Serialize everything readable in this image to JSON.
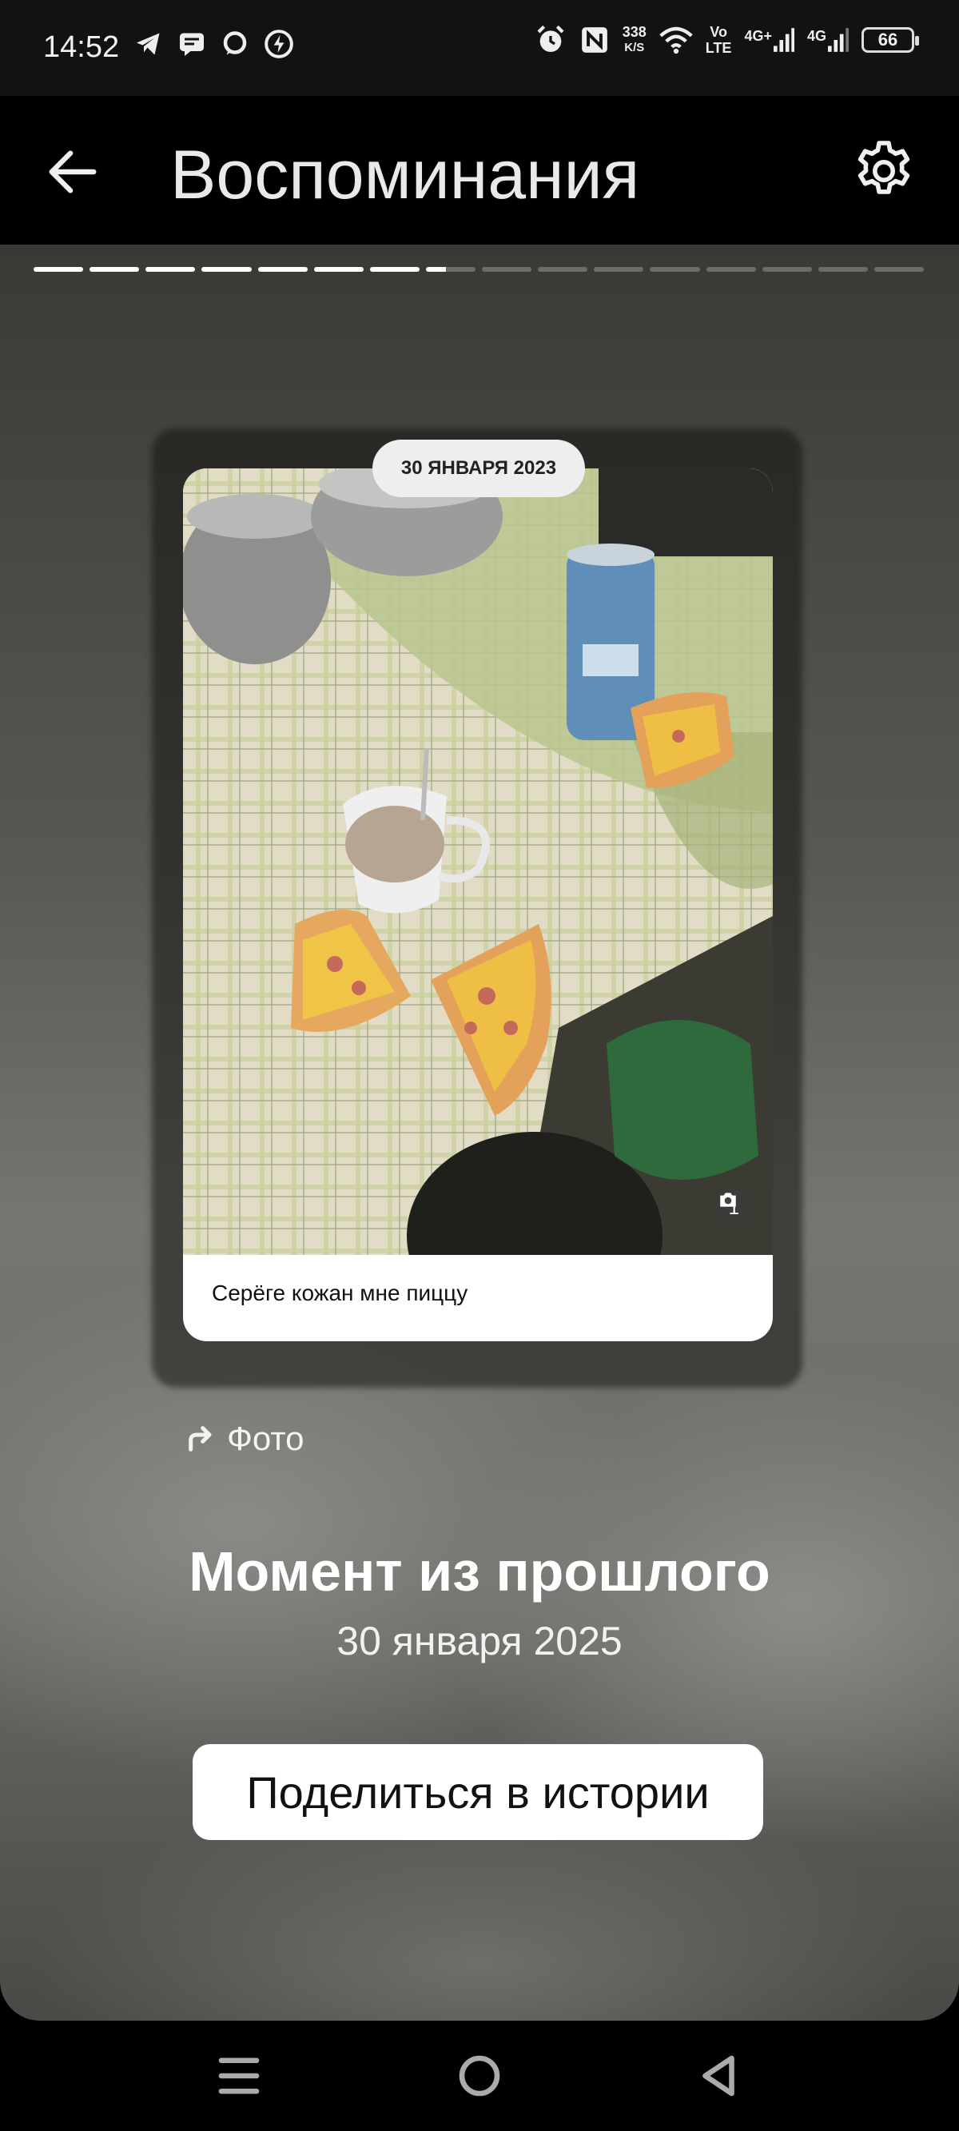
{
  "status_bar": {
    "time": "14:52",
    "left_icons": [
      "telegram-icon",
      "message-icon",
      "chat-bubble-icon",
      "messenger-icon"
    ],
    "speed_value": "338",
    "speed_unit": "K/S",
    "volte_top": "Vo",
    "volte_bottom": "LTE",
    "net1": "4G+",
    "net2": "4G",
    "battery": "66"
  },
  "header": {
    "title": "Воспоминания",
    "back_icon": "arrow-left-icon",
    "settings_icon": "gear-icon"
  },
  "progress": {
    "total": 16,
    "completed": 7,
    "current_fraction": 0.4
  },
  "memory": {
    "date_chip": "30 ЯНВАРЯ 2023",
    "caption": "Серёге кожан мне пиццу",
    "photo_count": "1",
    "source_label": "Фото",
    "title": "Момент из прошлого",
    "date": "30 января 2025",
    "share_label": "Поделиться в истории"
  },
  "nav": {
    "items": [
      "menu-icon",
      "home-icon",
      "back-icon"
    ]
  }
}
